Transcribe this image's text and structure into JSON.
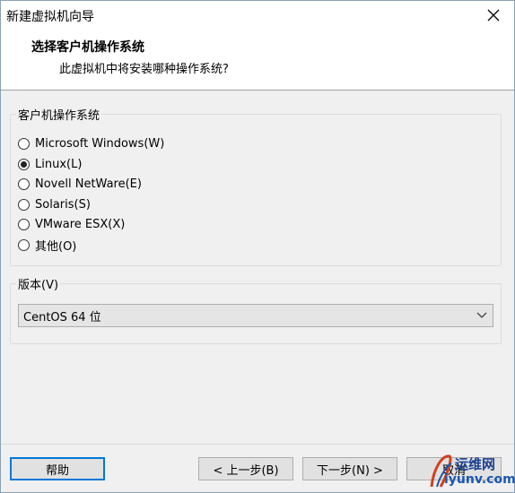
{
  "window": {
    "title": "新建虚拟机向导",
    "close_icon": "close-icon"
  },
  "header": {
    "title": "选择客户机操作系统",
    "subtitle": "此虚拟机中将安装哪种操作系统?"
  },
  "guest_os": {
    "legend": "客户机操作系统",
    "options": [
      {
        "label": "Microsoft Windows(W)",
        "checked": false
      },
      {
        "label": "Linux(L)",
        "checked": true
      },
      {
        "label": "Novell NetWare(E)",
        "checked": false
      },
      {
        "label": "Solaris(S)",
        "checked": false
      },
      {
        "label": "VMware ESX(X)",
        "checked": false
      },
      {
        "label": "其他(O)",
        "checked": false
      }
    ]
  },
  "version": {
    "legend": "版本(V)",
    "selected": "CentOS 64 位"
  },
  "footer": {
    "help": "帮助",
    "back": "< 上一步(B)",
    "next": "下一步(N) >",
    "cancel": "取消"
  },
  "watermark": {
    "top": "运维网",
    "bottom": "iyunv.com"
  },
  "colors": {
    "accent": "#0078d7",
    "watermark": "#1a3f8f"
  }
}
